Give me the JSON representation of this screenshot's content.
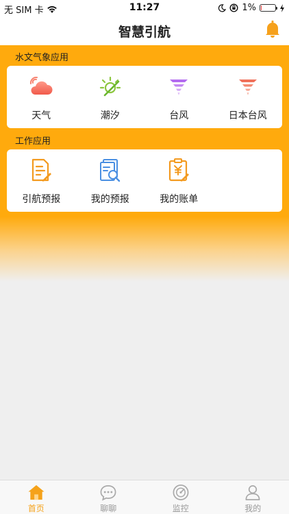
{
  "status_bar": {
    "carrier": "无 SIM 卡",
    "time": "11:27",
    "battery": "1%",
    "battery_level": 0.01
  },
  "header": {
    "title": "智慧引航",
    "bell_icon": "bell-icon"
  },
  "sections": [
    {
      "title": "水文气象应用",
      "items": [
        {
          "label": "天气",
          "icon": "weather-cloud-icon"
        },
        {
          "label": "潮汐",
          "icon": "tide-icon"
        },
        {
          "label": "台风",
          "icon": "typhoon-icon"
        },
        {
          "label": "日本台风",
          "icon": "japan-typhoon-icon"
        }
      ]
    },
    {
      "title": "工作应用",
      "items": [
        {
          "label": "引航预报",
          "icon": "pilot-forecast-icon"
        },
        {
          "label": "我的预报",
          "icon": "my-forecast-icon"
        },
        {
          "label": "我的账单",
          "icon": "my-bill-icon"
        }
      ]
    }
  ],
  "tab_bar": {
    "tabs": [
      {
        "label": "首页",
        "icon": "home-icon",
        "active": true
      },
      {
        "label": "聊聊",
        "icon": "chat-icon",
        "active": false
      },
      {
        "label": "监控",
        "icon": "monitor-icon",
        "active": false
      },
      {
        "label": "我的",
        "icon": "profile-icon",
        "active": false
      }
    ]
  },
  "colors": {
    "accent": "#ffaa0d",
    "active_tab": "#f5a21a",
    "inactive_tab": "#999999"
  }
}
